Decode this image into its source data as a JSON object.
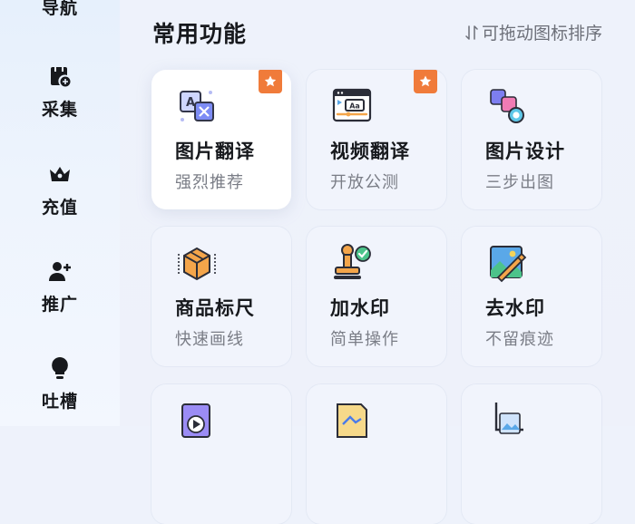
{
  "sidebar": {
    "items": [
      {
        "label": "导航",
        "icon": "compass-icon"
      },
      {
        "label": "采集",
        "icon": "collect-bag-icon"
      },
      {
        "label": "充值",
        "icon": "crown-icon"
      },
      {
        "label": "推广",
        "icon": "add-user-icon"
      },
      {
        "label": "吐槽",
        "icon": "lightbulb-icon"
      }
    ]
  },
  "main": {
    "title": "常用功能",
    "sort_hint": "可拖动图标排序",
    "sort_hint_icon": "sort-arrows-icon",
    "features": [
      {
        "name": "图片翻译",
        "sub": "强烈推荐",
        "icon": "image-translate-icon",
        "badge": true
      },
      {
        "name": "视频翻译",
        "sub": "开放公测",
        "icon": "video-translate-icon",
        "badge": true
      },
      {
        "name": "图片设计",
        "sub": "三步出图",
        "icon": "image-design-icon",
        "badge": false
      },
      {
        "name": "商品标尺",
        "sub": "快速画线",
        "icon": "product-ruler-icon",
        "badge": false
      },
      {
        "name": "加水印",
        "sub": "简单操作",
        "icon": "stamp-watermark-icon",
        "badge": false
      },
      {
        "name": "去水印",
        "sub": "不留痕迹",
        "icon": "remove-watermark-icon",
        "badge": false
      }
    ]
  },
  "colors": {
    "badge": "#f07b3a",
    "accent_blue": "#4a7bea",
    "background": "#eef2fb"
  }
}
